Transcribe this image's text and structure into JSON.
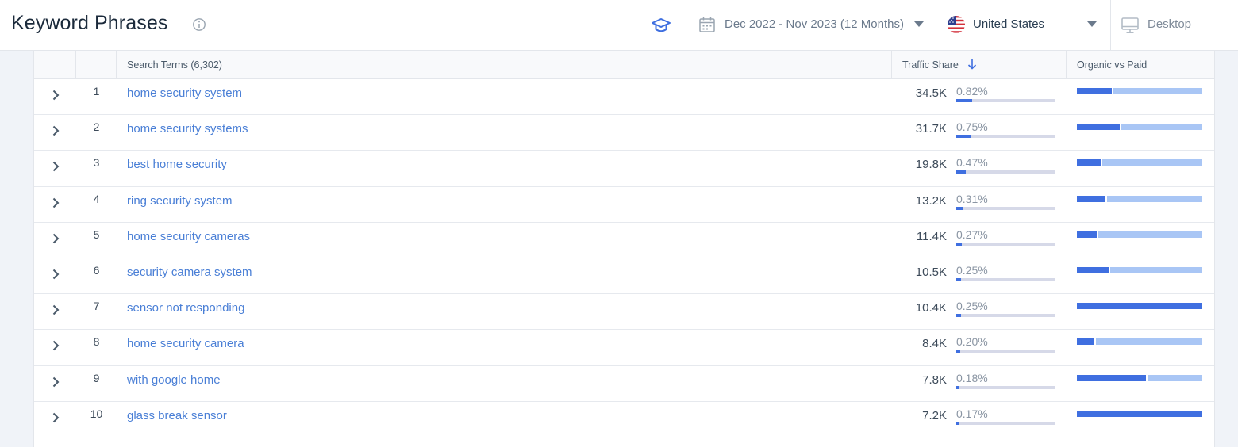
{
  "header": {
    "title": "Keyword Phrases",
    "date_range": "Dec 2022 - Nov 2023 (12 Months)",
    "country": "United States",
    "device": "Desktop"
  },
  "table": {
    "columns": {
      "search_terms": "Search Terms (6,302)",
      "traffic_share": "Traffic Share",
      "organic_vs_paid": "Organic vs Paid"
    },
    "rows": [
      {
        "rank": "1",
        "term": "home security system",
        "volume": "34.5K",
        "share": "0.82%",
        "share_value": 0.82,
        "organic_fraction": 0.28
      },
      {
        "rank": "2",
        "term": "home security systems",
        "volume": "31.7K",
        "share": "0.75%",
        "share_value": 0.75,
        "organic_fraction": 0.34
      },
      {
        "rank": "3",
        "term": "best home security",
        "volume": "19.8K",
        "share": "0.47%",
        "share_value": 0.47,
        "organic_fraction": 0.19
      },
      {
        "rank": "4",
        "term": "ring security system",
        "volume": "13.2K",
        "share": "0.31%",
        "share_value": 0.31,
        "organic_fraction": 0.23
      },
      {
        "rank": "5",
        "term": "home security cameras",
        "volume": "11.4K",
        "share": "0.27%",
        "share_value": 0.27,
        "organic_fraction": 0.16
      },
      {
        "rank": "6",
        "term": "security camera system",
        "volume": "10.5K",
        "share": "0.25%",
        "share_value": 0.25,
        "organic_fraction": 0.25
      },
      {
        "rank": "7",
        "term": "sensor not responding",
        "volume": "10.4K",
        "share": "0.25%",
        "share_value": 0.25,
        "organic_fraction": 1.0
      },
      {
        "rank": "8",
        "term": "home security camera",
        "volume": "8.4K",
        "share": "0.20%",
        "share_value": 0.2,
        "organic_fraction": 0.14
      },
      {
        "rank": "9",
        "term": "with google home",
        "volume": "7.8K",
        "share": "0.18%",
        "share_value": 0.18,
        "organic_fraction": 0.55
      },
      {
        "rank": "10",
        "term": "glass break sensor",
        "volume": "7.2K",
        "share": "0.17%",
        "share_value": 0.17,
        "organic_fraction": 1.0
      }
    ]
  },
  "colors": {
    "accent": "#3f6fe0",
    "paid": "#a9c6f5",
    "link": "#4a7fd6",
    "bar_track": "#d6d9e8"
  },
  "icons": [
    "info-icon",
    "graduation-cap-icon",
    "calendar-icon",
    "caret-down-icon",
    "us-flag-icon",
    "desktop-icon",
    "sort-arrow-down-icon",
    "chevron-right-icon"
  ]
}
